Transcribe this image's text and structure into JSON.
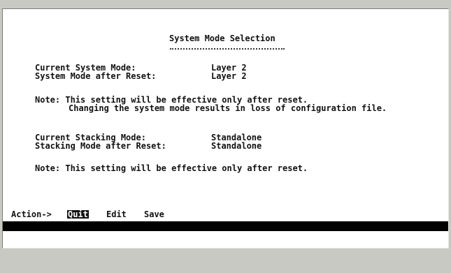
{
  "screen": {
    "title": "System Mode Selection"
  },
  "system_mode": {
    "current_label": "Current System Mode:",
    "current_value": "Layer 2",
    "after_reset_label": "System Mode after Reset:",
    "after_reset_value": "Layer 2"
  },
  "note1": {
    "line1": "Note: This setting will be effective only after reset.",
    "line2": "Changing the system mode results in loss of configuration file."
  },
  "stacking_mode": {
    "current_label": "Current Stacking Mode:",
    "current_value": "Standalone",
    "after_reset_label": "Stacking Mode after Reset:",
    "after_reset_value": "Standalone"
  },
  "note2": {
    "line1": "Note: This setting will be effective only after reset."
  },
  "action_bar": {
    "prompt": "Action->",
    "items": [
      "Quit",
      "Edit",
      "Save"
    ],
    "selected": "Quit"
  }
}
